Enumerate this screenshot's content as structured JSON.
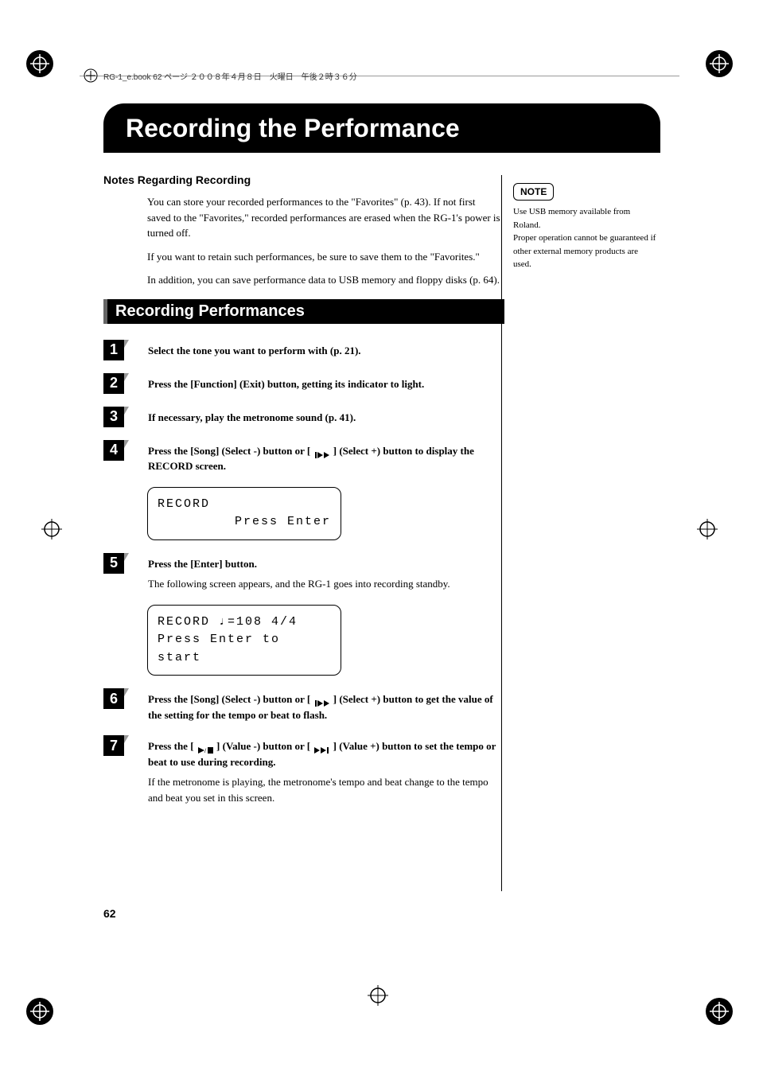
{
  "header_text": "RG-1_e.book 62 ページ ２００８年４月８日　火曜日　午後２時３６分",
  "chapter_title": "Recording the Performance",
  "notes_title": "Notes Regarding Recording",
  "notes_para1": "You can store your recorded performances to the \"Favorites\" (p. 43). If not first saved to the \"Favorites,\" recorded performances are erased when the RG-1's power is turned off.",
  "notes_para2": "If you want to retain such performances, be sure to save them to the \"Favorites.\"",
  "notes_para3": "In addition, you can save performance data to USB memory and floppy disks (p. 64).",
  "section_title": "Recording Performances",
  "steps": {
    "1": {
      "bold": "Select the tone you want to perform with (p. 21)."
    },
    "2": {
      "bold": "Press the [Function] (Exit) button, getting its indicator to light."
    },
    "3": {
      "bold": "If necessary, play the metronome sound (p. 41)."
    },
    "4": {
      "bold_pre": "Press the [Song] (Select -) button or [ ",
      "bold_post": " ] (Select +) button to display the RECORD screen."
    },
    "5": {
      "bold": "Press the [Enter] button.",
      "normal": "The following screen appears, and the RG-1 goes into recording standby."
    },
    "6": {
      "bold_pre": "Press the [Song] (Select -) button or [ ",
      "bold_post": " ] (Select +) button to get the value of the setting for the tempo or beat to flash."
    },
    "7": {
      "bold_pre": "Press the [ ",
      "bold_mid": " ] (Value -) button or [ ",
      "bold_post": " ] (Value +) button to set the tempo or beat to use during recording.",
      "normal": "If the metronome is playing, the metronome's tempo and beat change to the tempo and beat you set in this screen."
    }
  },
  "lcd1": {
    "line1": "RECORD",
    "line2": "Press Enter"
  },
  "lcd2": {
    "line1": "RECORD   ♩=108  4/4",
    "line2": "Press Enter to start"
  },
  "sidebar": {
    "note_label": "NOTE",
    "text": "Use USB memory available from Roland.\nProper operation cannot be guaranteed if other external memory products are used."
  },
  "page_number": "62"
}
